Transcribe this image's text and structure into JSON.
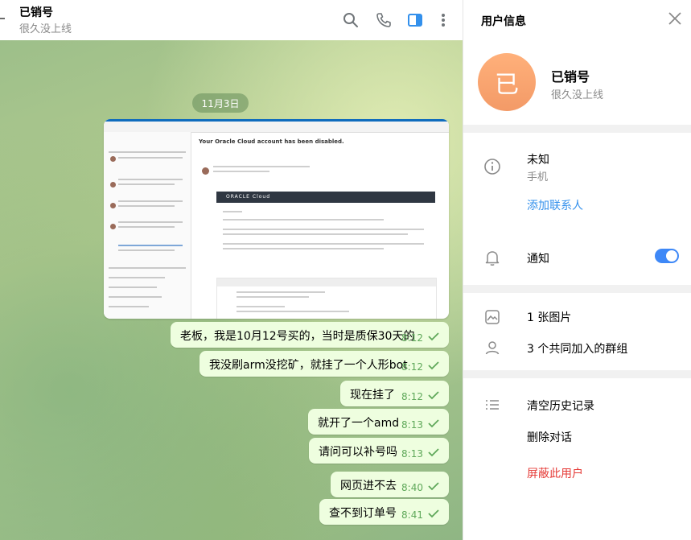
{
  "chat": {
    "title": "已销号",
    "status": "很久没上线",
    "date_label": "11月3日",
    "image_subject": "Your Oracle Cloud account has been disabled.",
    "image_banner": "ORACLE Cloud",
    "messages": [
      {
        "text": "老板，我是10月12号买的，当时是质保30天的",
        "time": "8:12"
      },
      {
        "text": "我没刷arm没挖矿，就挂了一个人形bot",
        "time": "8:12"
      },
      {
        "text": "现在挂了",
        "time": "8:12"
      },
      {
        "text": "就开了一个amd",
        "time": "8:13"
      },
      {
        "text": "请问可以补号吗",
        "time": "8:13"
      },
      {
        "text": "网页进不去",
        "time": "8:40"
      },
      {
        "text": "查不到订单号",
        "time": "8:41"
      }
    ]
  },
  "panel": {
    "title": "用户信息",
    "avatar_letter": "已",
    "name": "已销号",
    "status": "很久没上线",
    "phone_value": "未知",
    "phone_label": "手机",
    "add_contact": "添加联系人",
    "notifications": "通知",
    "notifications_on": true,
    "photos": "1 张图片",
    "groups": "3 个共同加入的群组",
    "clear_history": "清空历史记录",
    "delete_chat": "删除对话",
    "block_user": "屏蔽此用户"
  },
  "colors": {
    "bubble": "#eefedf",
    "accent_blue": "#3390ec",
    "danger_red": "#e53935",
    "avatar_orange": "#f39a67"
  }
}
